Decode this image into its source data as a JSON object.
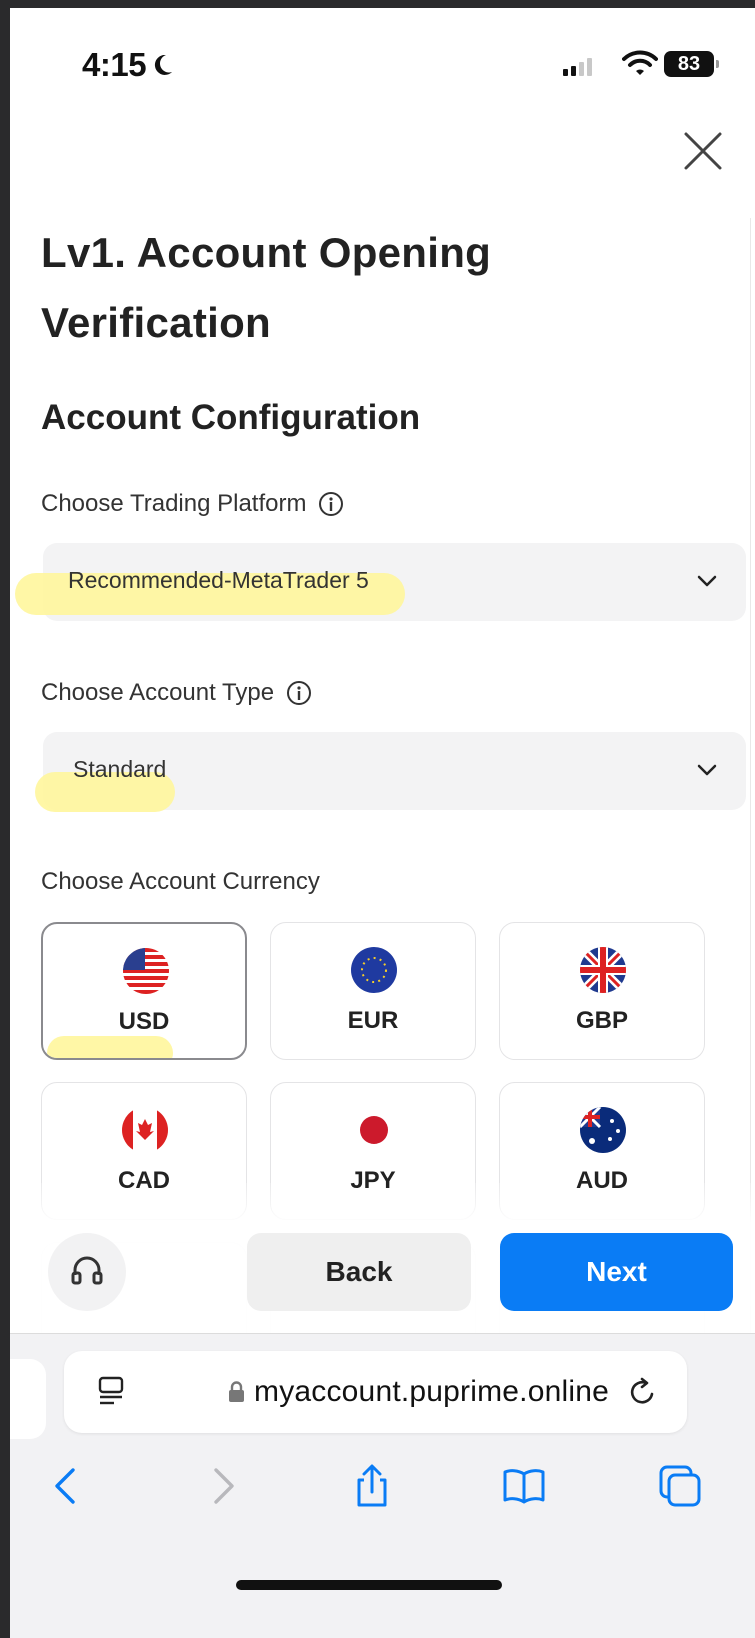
{
  "status_bar": {
    "time": "4:15",
    "battery": "83"
  },
  "page": {
    "title": "Lv1. Account Opening Verification",
    "section_title": "Account Configuration"
  },
  "fields": {
    "platform": {
      "label": "Choose Trading Platform",
      "value": "Recommended-MetaTrader 5"
    },
    "account_type": {
      "label": "Choose Account Type",
      "value": "Standard"
    },
    "currency": {
      "label": "Choose Account Currency",
      "selected": "USD",
      "options": [
        "USD",
        "EUR",
        "GBP",
        "CAD",
        "JPY",
        "AUD"
      ]
    }
  },
  "actions": {
    "back_label": "Back",
    "next_label": "Next"
  },
  "browser": {
    "url": "myaccount.puprime.online"
  },
  "colors": {
    "accent": "#0a7cf5",
    "highlight": "#fff696",
    "field_bg": "#f3f3f4"
  },
  "icons": [
    "moon-icon",
    "signal-icon",
    "wifi-icon",
    "close-icon",
    "info-icon",
    "chevron-down-icon",
    "headset-icon",
    "reader-icon",
    "lock-icon",
    "reload-icon",
    "back-arrow-icon",
    "forward-arrow-icon",
    "share-icon",
    "bookmarks-icon",
    "tabs-icon"
  ]
}
